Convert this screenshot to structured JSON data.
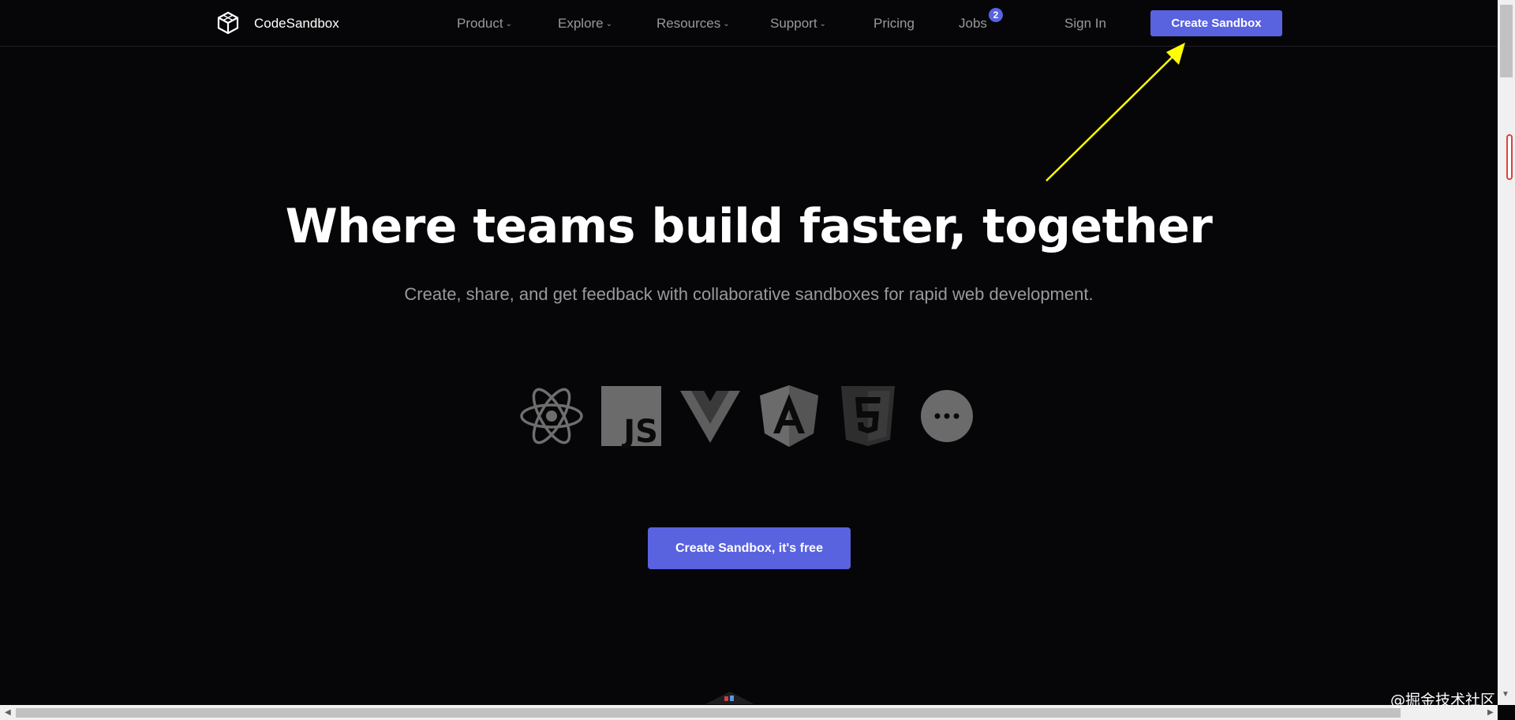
{
  "brand": {
    "name": "CodeSandbox",
    "logo_icon": "codesandbox-cube-icon"
  },
  "nav": {
    "items": [
      {
        "label": "Product",
        "has_dropdown": true
      },
      {
        "label": "Explore",
        "has_dropdown": true
      },
      {
        "label": "Resources",
        "has_dropdown": true
      },
      {
        "label": "Support",
        "has_dropdown": true
      },
      {
        "label": "Pricing",
        "has_dropdown": false
      },
      {
        "label": "Jobs",
        "has_dropdown": false
      }
    ],
    "jobs_badge": "2",
    "sign_in": "Sign In",
    "create_button": "Create Sandbox",
    "dropdown_glyph": "⌄"
  },
  "hero": {
    "headline": "Where teams build faster, together",
    "subheadline": "Create, share, and get feedback with collaborative sandboxes for rapid web development.",
    "frameworks": [
      "react-icon",
      "javascript-icon",
      "vue-icon",
      "angular-icon",
      "html5-icon",
      "more-icon"
    ],
    "cta": "Create Sandbox, it's free"
  },
  "watermark": "@掘金技术社区",
  "colors": {
    "accent": "#5962df",
    "background": "#060608",
    "muted_text": "#999999",
    "annotation_arrow": "#ffff00"
  }
}
